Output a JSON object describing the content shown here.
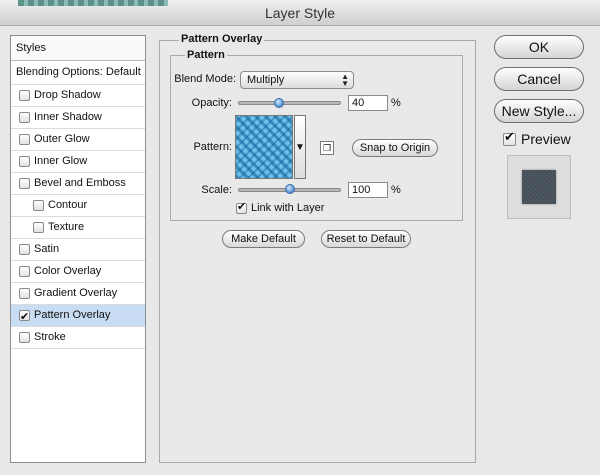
{
  "window": {
    "title": "Layer Style"
  },
  "styles_panel": {
    "header": "Styles",
    "blending": "Blending Options: Default",
    "items": [
      {
        "label": "Drop Shadow",
        "checked": false,
        "indent": false
      },
      {
        "label": "Inner Shadow",
        "checked": false,
        "indent": false
      },
      {
        "label": "Outer Glow",
        "checked": false,
        "indent": false
      },
      {
        "label": "Inner Glow",
        "checked": false,
        "indent": false
      },
      {
        "label": "Bevel and Emboss",
        "checked": false,
        "indent": false
      },
      {
        "label": "Contour",
        "checked": false,
        "indent": true
      },
      {
        "label": "Texture",
        "checked": false,
        "indent": true
      },
      {
        "label": "Satin",
        "checked": false,
        "indent": false
      },
      {
        "label": "Color Overlay",
        "checked": false,
        "indent": false
      },
      {
        "label": "Gradient Overlay",
        "checked": false,
        "indent": false
      },
      {
        "label": "Pattern Overlay",
        "checked": true,
        "indent": false,
        "selected": true
      },
      {
        "label": "Stroke",
        "checked": false,
        "indent": false
      }
    ]
  },
  "pattern_overlay": {
    "group_title": "Pattern Overlay",
    "sub_title": "Pattern",
    "blend_mode_label": "Blend Mode:",
    "blend_mode_value": "Multiply",
    "opacity_label": "Opacity:",
    "opacity_value": "40",
    "opacity_fraction": 0.4,
    "percent_sign": "%",
    "pattern_label": "Pattern:",
    "snap_button": "Snap to Origin",
    "scale_label": "Scale:",
    "scale_value": "100",
    "scale_fraction": 0.5,
    "link_label": "Link with Layer",
    "link_checked": true,
    "make_default": "Make Default",
    "reset_default": "Reset to Default"
  },
  "right_panel": {
    "ok": "OK",
    "cancel": "Cancel",
    "new_style": "New Style...",
    "preview_label": "Preview",
    "preview_checked": true
  },
  "colors": {
    "selection": "#c8dcf4",
    "pattern": "#6cc2ea",
    "preview_swatch": "#4d5862",
    "slider_thumb": "#5f9ad8"
  },
  "icons": {
    "pattern_picker": "triangle-down-icon",
    "new_preset": "new-preset-icon",
    "select_arrows": "updown-arrows-icon"
  }
}
